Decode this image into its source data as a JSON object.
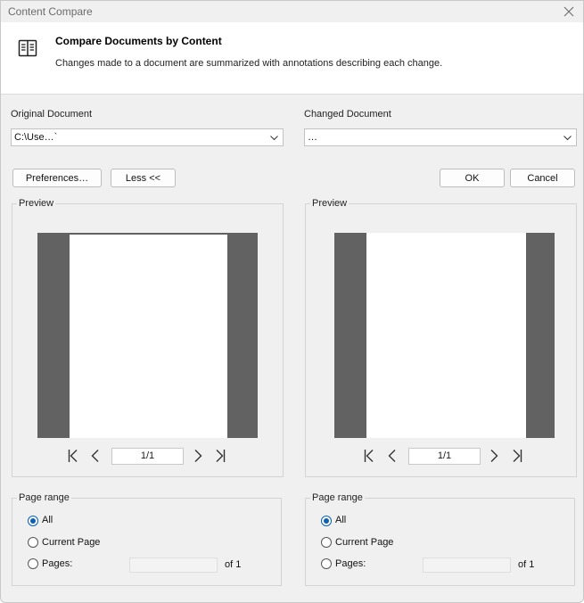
{
  "window": {
    "title": "Content Compare"
  },
  "header": {
    "title": "Compare Documents by Content",
    "description": "Changes made to a document are summarized with annotations describing each change."
  },
  "original": {
    "label": "Original Document",
    "value": "C:\\Use…`"
  },
  "changed": {
    "label": "Changed Document",
    "value": "…"
  },
  "buttons": {
    "preferences": "Preferences…",
    "less": "Less <<",
    "ok": "OK",
    "cancel": "Cancel"
  },
  "left_preview": {
    "label": "Preview",
    "page_indicator": "1/1"
  },
  "right_preview": {
    "label": "Preview",
    "page_indicator": "1/1"
  },
  "left_range": {
    "label": "Page range",
    "options": [
      "All",
      "Current Page",
      "Pages:"
    ],
    "selected": "All",
    "pages_value": "",
    "of_text": "of 1"
  },
  "right_range": {
    "label": "Page range",
    "options": [
      "All",
      "Current Page",
      "Pages:"
    ],
    "selected": "All",
    "pages_value": "",
    "of_text": "of 1"
  },
  "colors": {
    "accent": "#0b5fb5",
    "page_frame": "#626262",
    "background": "#f0f0f0"
  }
}
